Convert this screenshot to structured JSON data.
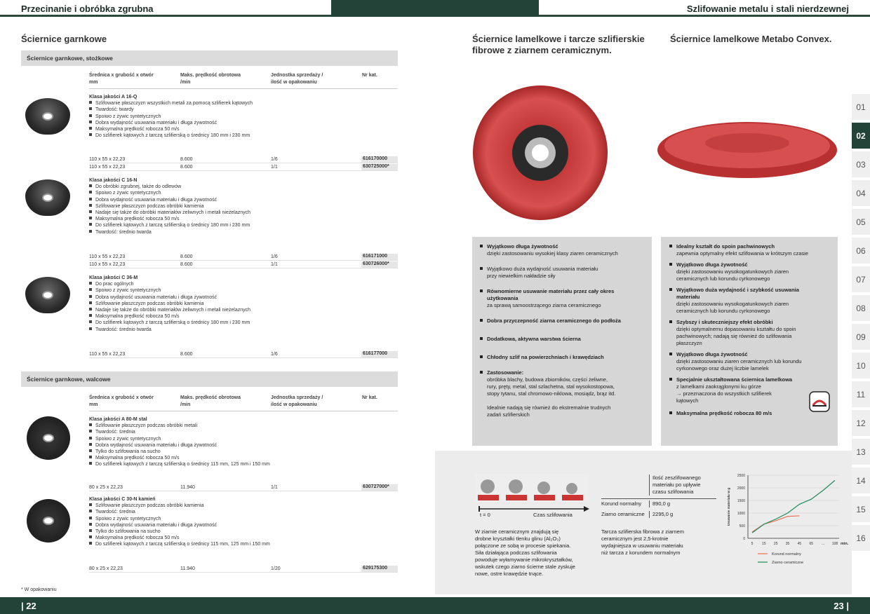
{
  "header": {
    "left": "Przecinanie i obróbka zgrubna",
    "right": "Szlifowanie metalu i stali nierdzewnej"
  },
  "footer": {
    "left": "| 22",
    "right": "23 |"
  },
  "tabs": [
    "01",
    "02",
    "03",
    "04",
    "05",
    "06",
    "07",
    "08",
    "09",
    "10",
    "11",
    "12",
    "13",
    "14",
    "15",
    "16"
  ],
  "active_tab": "02",
  "left": {
    "title": "Ściernice garnkowe",
    "band1": "Ściernice garnkowe, stożkowe",
    "band2": "Ściernice garnkowe, walcowe",
    "cols": [
      "Średnica x grubość x otwór mm",
      "Maks. prędkość obrotowa /min",
      "Jednostka sprzedaży / ilość w opakowaniu",
      "Nr kat."
    ],
    "cols_l1": [
      "Średnica x grubość x otwór",
      "Maks. prędkość obrotowa",
      "Jednostka sprzedaży /",
      "Nr kat."
    ],
    "cols_l2": [
      "mm",
      "/min",
      "ilość w opakowaniu",
      ""
    ],
    "products": [
      {
        "name": "Klasa jakości A 16-Q",
        "lines": [
          "Szlifowanie płaszczyzn wszystkich metali za pomocą szlifierek kątowych",
          "Twardość: twardy",
          "Spoiwo z żywic syntetycznych",
          "Dobra wydajność usuwania materiału i długa żywotność",
          "Maksymalna prędkość robocza 50 m/s",
          "Do szlifierek kątowych z tarczą szlifierską o średnicy 180 mm i 230 mm"
        ],
        "rows": [
          [
            "110 x 55 x 22,23",
            "8.600",
            "1/6",
            "616170000"
          ],
          [
            "110 x 55 x 22,23",
            "8.600",
            "1/1",
            "630725000*"
          ]
        ]
      },
      {
        "name": "Klasa jakości C 16-N",
        "lines": [
          "Do obróbki zgrubnej, także do odlewów",
          "Spoiwo z żywic syntetycznych",
          "Dobra wydajność usuwania materiału i długa żywotność",
          "Szlifowanie płaszczyzn podczas obróbki kamienia",
          "Nadaje się także do obróbki materiałów żeliwnych i metali nieżelaznych",
          "Maksymalna prędkość robocza 50 m/s",
          "Do szlifierek kątowych z tarczą szlifierską o średnicy 180 mm i 230 mm",
          "Twardość: średnio twarda"
        ],
        "rows": [
          [
            "110 x 55 x 22,23",
            "8.600",
            "1/6",
            "616171000"
          ],
          [
            "110 x 55 x 22,23",
            "8.600",
            "1/1",
            "630726000*"
          ]
        ]
      },
      {
        "name": "Klasa jakości C 36-M",
        "lines": [
          "Do prac ogólnych",
          "Spoiwo z żywic syntetycznych",
          "Dobra wydajność usuwania materiału i długa żywotność",
          "Szlifowanie płaszczyzn podczas obróbki kamienia",
          "Nadaje się także do obróbki materiałów żeliwnych i metali nieżelaznych",
          "Maksymalna prędkość robocza 50 m/s",
          "Do szlifierek kątowych z tarczą szlifierską o średnicy 180 mm i 230 mm",
          "Twardość: średnio twarda"
        ],
        "rows": [
          [
            "110 x 55 x 22,23",
            "8.600",
            "1/6",
            "616177000"
          ]
        ]
      },
      {
        "name": "Klasa jakości A 80-M stal",
        "lines": [
          "Szlifowanie płaszczyzn podczas obróbki metali",
          "Twardość: średnia",
          "Spoiwo z żywic syntetycznych",
          "Dobra wydajność usuwania materiału i długa żywotność",
          "Tylko do szlifowania na sucho",
          "Maksymalna prędkość robocza 50 m/s",
          "Do szlifierek kątowych z tarczą szlifierską o średnicy 115 mm, 125 mm i 150 mm"
        ],
        "rows": [
          [
            "80 x 25 x 22,23",
            "11.940",
            "1/1",
            "630727000*"
          ]
        ]
      },
      {
        "name": "Klasa jakości C 30-N kamień",
        "lines": [
          "Szlifowanie płaszczyzn podczas obróbki kamienia",
          "Twardość: średnia",
          "Spoiwo z żywic syntetycznych",
          "Dobra wydajność usuwania materiału i długa żywotność",
          "Tylko do szlifowania na sucho",
          "Maksymalna prędkość robocza 50 m/s",
          "Do szlifierek kątowych z tarczą szlifierską o średnicy 115 mm, 125 mm i 150 mm"
        ],
        "rows": [
          [
            "80 x 25 x 22,23",
            "11.940",
            "1/20",
            "629175300"
          ]
        ]
      }
    ],
    "footnote": "* W opakowaniu"
  },
  "mid": {
    "title_l1": "Ściernice lamelkowe i tarcze szlifierskie",
    "title_l2": "fibrowe z ziarnem ceramicznym.",
    "features": [
      {
        "b": "Wyjątkowo długa żywotność",
        "t": [
          "dzięki zastosowaniu wysokiej klasy ziaren ceramicznych"
        ]
      },
      {
        "b": "",
        "t": [
          "Wyjątkowo duża wydajność usuwania materiału",
          "przy niewielkim nakładzie siły"
        ]
      },
      {
        "b": "Równomierne usuwanie materiału przez cały okres użytkowania",
        "t": [
          "za sprawą samoostrzącego ziarna ceramicznego"
        ]
      },
      {
        "b": "Dobra przyczepność ziarna ceramicznego do podłoża",
        "t": []
      },
      {
        "b": "Dodatkowa, aktywna warstwa ścierna",
        "t": []
      },
      {
        "b": "Chłodny szlif na powierzchniach i krawędziach",
        "t": []
      },
      {
        "b": "Zastosowanie:",
        "t": [
          "obróbka blachy, budowa zbiorników, części żeliwne,",
          "rury, pręty, metal, stal szlachetna, stal wysokostopowa,",
          "stopy tytanu, stal chromowo-niklowa, mosiądz, brąz itd."
        ]
      }
    ],
    "extra": [
      "Idealnie nadają się również do ekstremalnie trudnych",
      "zadań szlifierskich"
    ]
  },
  "right": {
    "title": "Ściernice lamelkowe Metabo Convex.",
    "features": [
      {
        "b": [
          "Idealny kształt do spoin pachwinowych"
        ],
        "t": [
          "zapewnia optymalny efekt szlifowania w krótszym czasie"
        ]
      },
      {
        "b": [
          "Wyjątkowo długa żywotność"
        ],
        "t": [
          "dzięki zastosowaniu wysokogatunkowych ziaren",
          "ceramicznych lub korundu cyrkonowego"
        ]
      },
      {
        "b": [
          "Wyjątkowo duża wydajność i szybkość usuwania",
          "materiału"
        ],
        "t": [
          "dzięki zastosowaniu wysokogatunkowych ziaren",
          "ceramicznych lub korundu cyrkonowego"
        ]
      },
      {
        "b": [
          "Szybszy i skuteczniejszy efekt obróbki"
        ],
        "t": [
          "dzięki optymalnemu dopasowaniu kształtu do spoin",
          "pachwinowych; nadają się również do szlifowania",
          "płaszczyzn"
        ]
      },
      {
        "b": [
          "Wyjątkowo długa żywotność"
        ],
        "t": [
          "dzięki zastosowaniu ziaren ceramicznych lub korundu",
          "cyrkonowego oraz dużej liczbie lamelek"
        ]
      },
      {
        "b": [
          "Specjalnie ukształtowana ściernica lamelkowa"
        ],
        "t": [
          "z lamelkami zaokrąglonymi ku górze",
          "→ przeznaczona do wszystkich szlifierek",
          "kątowych"
        ]
      },
      {
        "b": [
          "Maksymalna prędkość robocza 80 m/s"
        ],
        "t": []
      }
    ]
  },
  "info": {
    "timeline_l": "t = 0",
    "timeline_r": "Czas szlifowania",
    "desc": [
      "W ziarnie ceramicznym znajdują się",
      "drobne kryształki tlenku glinu (Al₂O₃)",
      "połączone ze sobą w procesie spiekania.",
      "Siła działająca podczas szlifowania",
      "powoduje wyłamywanie mikrokryształków,",
      "wskutek czego ziarno ścierne stale zyskuje",
      "nowe, ostre krawędzie tnące."
    ],
    "table_head": [
      "Ilość zeszlifowanego",
      "materiału po upływie",
      "czasu szlifowania"
    ],
    "table_rows": [
      [
        "Korund normalny",
        "890,0 g"
      ],
      [
        "Ziarno ceramiczne",
        "2295,0 g"
      ]
    ],
    "desc2": [
      "Tarcza szlifierska fibrowa z ziarnem",
      "ceramicznym jest 2,5-krotnie",
      "wydajniejsza w usuwaniu materiału",
      "niż tarcza z korundem normalnym"
    ]
  },
  "chart_data": {
    "type": "line",
    "x": [
      "5",
      "15",
      "25",
      "35",
      "45",
      "65",
      "...",
      "108"
    ],
    "xlabel": "min.",
    "ylabel": "Usuwanie materiału w g",
    "yticks": [
      "0",
      "500",
      "1000",
      "1500",
      "2000",
      "2500"
    ],
    "ylim": [
      0,
      2500
    ],
    "series": [
      {
        "name": "Korund normalny",
        "color": "#f07050",
        "values": [
          250,
          560,
          700,
          870,
          890
        ]
      },
      {
        "name": "Ziarno ceramiczne",
        "color": "#1e8a5a",
        "values": [
          220,
          560,
          760,
          1000,
          1350,
          1550,
          1900,
          2295
        ]
      }
    ]
  }
}
